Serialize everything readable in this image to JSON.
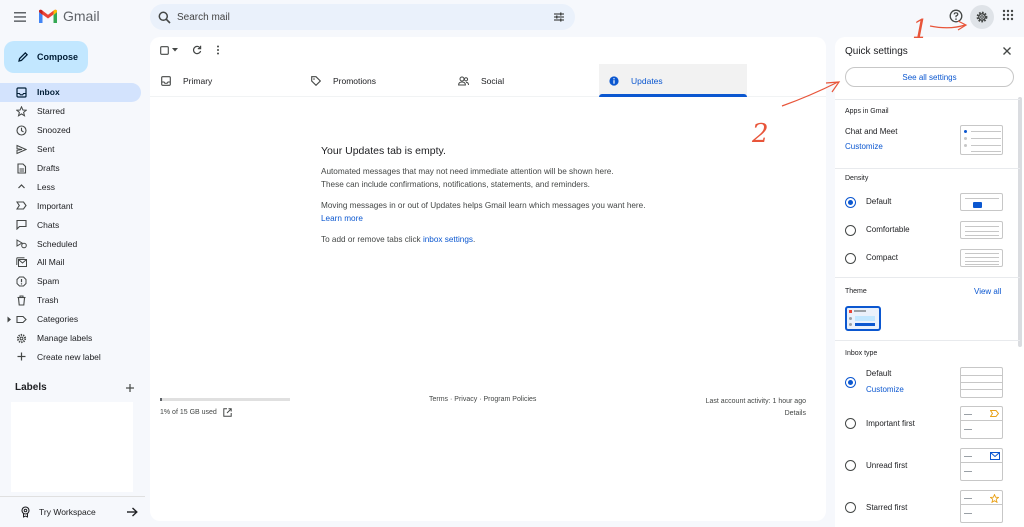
{
  "app": {
    "name": "Gmail"
  },
  "search": {
    "placeholder": "Search mail"
  },
  "compose": {
    "label": "Compose"
  },
  "nav": [
    {
      "label": "Inbox",
      "icon": "inbox-icon",
      "active": true
    },
    {
      "label": "Starred",
      "icon": "star-icon"
    },
    {
      "label": "Snoozed",
      "icon": "clock-icon"
    },
    {
      "label": "Sent",
      "icon": "send-icon"
    },
    {
      "label": "Drafts",
      "icon": "draft-icon"
    },
    {
      "label": "Less",
      "icon": "chevron-up-icon"
    },
    {
      "label": "Important",
      "icon": "important-icon"
    },
    {
      "label": "Chats",
      "icon": "chat-icon"
    },
    {
      "label": "Scheduled",
      "icon": "scheduled-icon"
    },
    {
      "label": "All Mail",
      "icon": "all-mail-icon"
    },
    {
      "label": "Spam",
      "icon": "spam-icon"
    },
    {
      "label": "Trash",
      "icon": "trash-icon"
    },
    {
      "label": "Categories",
      "icon": "label-icon"
    },
    {
      "label": "Manage labels",
      "icon": "gear-icon"
    },
    {
      "label": "Create new label",
      "icon": "plus-icon"
    }
  ],
  "labels": {
    "title": "Labels"
  },
  "workspace": {
    "label": "Try Workspace"
  },
  "tabs": [
    {
      "label": "Primary",
      "icon": "inbox-icon"
    },
    {
      "label": "Promotions",
      "icon": "tag-icon"
    },
    {
      "label": "Social",
      "icon": "people-icon"
    },
    {
      "label": "Updates",
      "icon": "info-icon",
      "active": true
    }
  ],
  "empty_state": {
    "title": "Your Updates tab is empty.",
    "line1": "Automated messages that may not need immediate attention will be shown here.",
    "line2": "These can include confirmations, notifications, statements, and reminders.",
    "line3": "Moving messages in or out of Updates helps Gmail learn which messages you want here.",
    "learn_more": "Learn more",
    "line4": "To add or remove tabs click",
    "inbox_settings": "inbox settings",
    "period": "."
  },
  "footer": {
    "storage_text": "1% of 15 GB used",
    "storage_fraction": 0.01,
    "terms": "Terms",
    "sep": " · ",
    "privacy": "Privacy",
    "policies": "Program Policies",
    "activity": "Last account activity: 1 hour ago",
    "details": "Details"
  },
  "quick_settings": {
    "title": "Quick settings",
    "see_all": "See all settings",
    "apps_title": "Apps in Gmail",
    "chat_meet": "Chat and Meet",
    "customize": "Customize",
    "density_title": "Density",
    "density_options": [
      "Default",
      "Comfortable",
      "Compact"
    ],
    "density_selected": "Default",
    "theme_title": "Theme",
    "view_all": "View all",
    "inbox_type_title": "Inbox type",
    "inbox_options": [
      "Default",
      "Important first",
      "Unread first",
      "Starred first"
    ],
    "inbox_selected": "Default",
    "inbox_customize": "Customize"
  },
  "annotations": {
    "step1": "1",
    "step2": "2",
    "color": "#e8553a"
  },
  "colors": {
    "accent": "#0b57d0",
    "compose_bg": "#c2e7ff",
    "active_nav": "#d3e3fd"
  }
}
